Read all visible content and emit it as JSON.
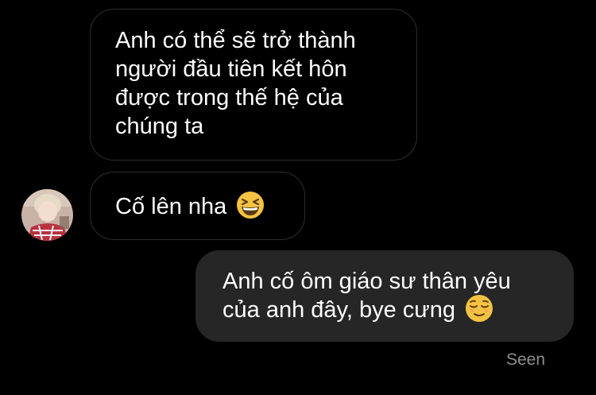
{
  "messages": [
    {
      "direction": "incoming",
      "lines": [
        "Anh có thể sẽ trở thành",
        "người đầu tiên kết hôn",
        "được trong thế hệ của",
        "chúng ta"
      ]
    },
    {
      "direction": "incoming",
      "lines": [
        "Cố lên nha"
      ],
      "emoji": "grinning-squinting-face-emoji"
    },
    {
      "direction": "outgoing",
      "lines": [
        "Anh cố ôm giáo sư thân yêu",
        "của anh đây, bye cưng"
      ],
      "emoji": "relieved-face-emoji"
    }
  ],
  "seen_label": "Seen",
  "colors": {
    "background": "#000000",
    "incoming_border": "#2e2e2e",
    "outgoing_bubble": "#262626",
    "text": "#ffffff",
    "seen_text": "#8e8e8e",
    "emoji_yellow": "#f5c342"
  }
}
